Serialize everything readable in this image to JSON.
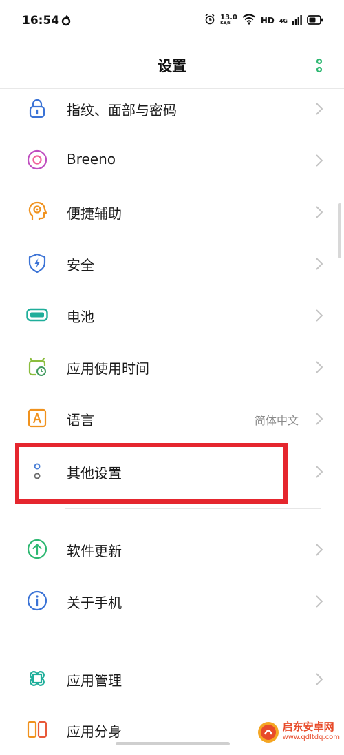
{
  "status_bar": {
    "time": "16:54",
    "net_speed_value": "13.0",
    "net_speed_unit": "KB/S",
    "hd_label": "HD",
    "network_label": "4G"
  },
  "header": {
    "title": "设置"
  },
  "items": [
    {
      "label": "指纹、面部与密码",
      "value": ""
    },
    {
      "label": "Breeno",
      "value": ""
    },
    {
      "label": "便捷辅助",
      "value": ""
    },
    {
      "label": "安全",
      "value": ""
    },
    {
      "label": "电池",
      "value": ""
    },
    {
      "label": "应用使用时间",
      "value": ""
    },
    {
      "label": "语言",
      "value": "简体中文"
    },
    {
      "label": "其他设置",
      "value": ""
    },
    {
      "label": "软件更新",
      "value": ""
    },
    {
      "label": "关于手机",
      "value": ""
    },
    {
      "label": "应用管理",
      "value": ""
    },
    {
      "label": "应用分身",
      "value": ""
    }
  ],
  "colors": {
    "highlight": "#e5262e",
    "icon_blue": "#3b73d6",
    "icon_green": "#2eb872",
    "icon_orange": "#f0921e"
  },
  "watermark": {
    "name": "启东安卓网",
    "url": "www.qdltdq.com"
  }
}
